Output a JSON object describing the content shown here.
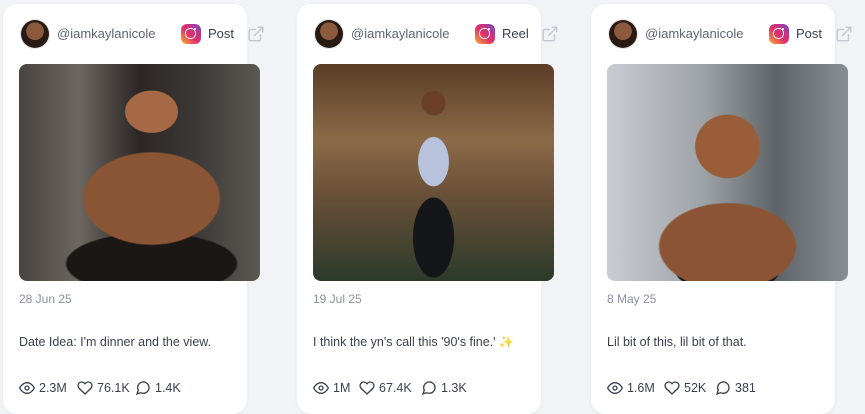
{
  "posts": [
    {
      "handle": "@iamkaylanicole",
      "platform_icon": "instagram-icon",
      "type": "Post",
      "date": "28 Jun 25",
      "caption": "Date Idea: I'm dinner and the view.",
      "caption_emoji": "",
      "views": "2.3M",
      "likes": "76.1K",
      "comments": "1.4K"
    },
    {
      "handle": "@iamkaylanicole",
      "platform_icon": "instagram-icon",
      "type": "Reel",
      "date": "19 Jul 25",
      "caption": "I think the yn's call this '90's fine.'",
      "caption_emoji": "✨",
      "views": "1M",
      "likes": "67.4K",
      "comments": "1.3K"
    },
    {
      "handle": "@iamkaylanicole",
      "platform_icon": "instagram-icon",
      "type": "Post",
      "date": "8 May 25",
      "caption": "Lil bit of this, lil bit of that.",
      "caption_emoji": "",
      "views": "1.6M",
      "likes": "52K",
      "comments": "381"
    }
  ]
}
